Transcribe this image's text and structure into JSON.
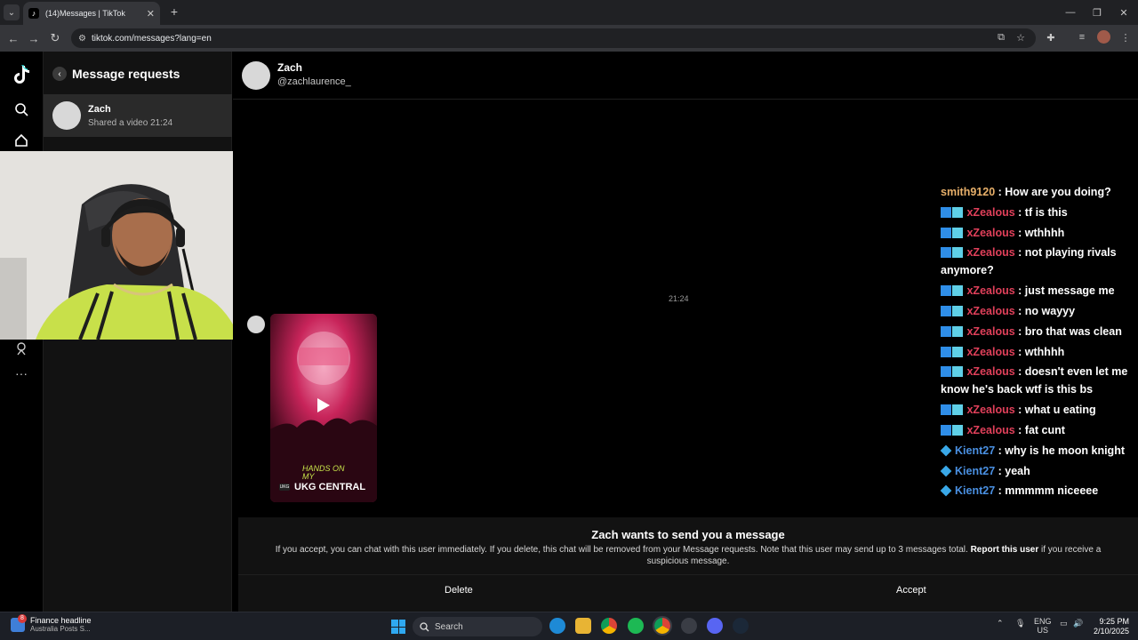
{
  "browser": {
    "tab_title": "(14)Messages | TikTok",
    "url": "tiktok.com/messages?lang=en"
  },
  "requests_panel": {
    "title": "Message requests",
    "items": [
      {
        "name": "Zach",
        "preview": "Shared a video",
        "time": "21:24"
      }
    ]
  },
  "chat": {
    "name": "Zach",
    "handle": "@zachlaurence_",
    "timestamp": "21:24",
    "video": {
      "caption_line1": "HANDS ON",
      "caption_line2": "MY",
      "source_logo": "UKG",
      "source": "UKG CENTRAL"
    },
    "request": {
      "title": "Zach wants to send you a message",
      "body_pre": "If you accept, you can chat with this user immediately. If you delete, this chat will be removed from your Message requests. Note that this user may send up to 3 messages total.",
      "report_link": "Report this user",
      "body_post": "if you receive a suspicious message.",
      "delete_label": "Delete",
      "accept_label": "Accept"
    }
  },
  "stream_chat": [
    {
      "user": "smith9120",
      "color": "#e8b06a",
      "badges": 0,
      "text": "How are you doing?"
    },
    {
      "user": "xZealous",
      "color": "#e0405a",
      "badges": 2,
      "text": "tf is this"
    },
    {
      "user": "xZealous",
      "color": "#e0405a",
      "badges": 2,
      "text": "wthhhh"
    },
    {
      "user": "xZealous",
      "color": "#e0405a",
      "badges": 2,
      "text": "not playing rivals anymore?"
    },
    {
      "user": "xZealous",
      "color": "#e0405a",
      "badges": 2,
      "text": "just message me"
    },
    {
      "user": "xZealous",
      "color": "#e0405a",
      "badges": 2,
      "text": "no wayyy"
    },
    {
      "user": "xZealous",
      "color": "#e0405a",
      "badges": 2,
      "text": "bro that was clean"
    },
    {
      "user": "xZealous",
      "color": "#e0405a",
      "badges": 2,
      "text": "wthhhh"
    },
    {
      "user": "xZealous",
      "color": "#e0405a",
      "badges": 2,
      "text": "doesn't even let me know he's back wtf is this bs"
    },
    {
      "user": "xZealous",
      "color": "#e0405a",
      "badges": 2,
      "text": "what u eating"
    },
    {
      "user": "xZealous",
      "color": "#e0405a",
      "badges": 2,
      "text": "fat cunt"
    },
    {
      "user": "Kient27",
      "color": "#4a90e2",
      "badges": 1,
      "text": "why is he moon knight"
    },
    {
      "user": "Kient27",
      "color": "#4a90e2",
      "badges": 1,
      "text": "yeah"
    },
    {
      "user": "Kient27",
      "color": "#4a90e2",
      "badges": 1,
      "text": "mmmmm niceeee"
    }
  ],
  "taskbar": {
    "widget_badge": "8",
    "widget_title": "Finance headline",
    "widget_sub": "Australia Posts S...",
    "search_label": "Search",
    "lang_top": "ENG",
    "lang_bottom": "US",
    "time": "9:25 PM",
    "date": "2/10/2025"
  }
}
